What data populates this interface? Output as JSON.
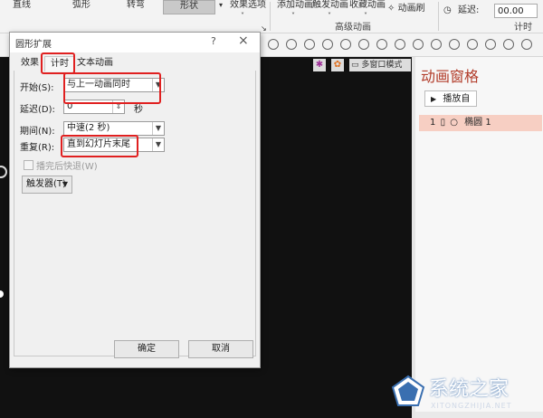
{
  "ribbon": {
    "tabs": [
      "直线",
      "弧形",
      "转弯",
      "形状"
    ],
    "selected_tab": "形状",
    "effect_options": "效果选项",
    "adv_buttons": [
      "添加动画",
      "触发动画",
      "收藏动画"
    ],
    "anim_painter": "动画刷",
    "group_advanced": "高级动画",
    "delay_label": "延迟:",
    "delay_value": "00.00",
    "group_timing": "计时"
  },
  "toolbar2": {
    "multi_window": "多窗口模式"
  },
  "anim_pane": {
    "title": "动画窗格",
    "play_from": "播放自",
    "item_index": "1",
    "item_name": "椭圆 1"
  },
  "dialog": {
    "title": "圆形扩展",
    "help": "?",
    "close": "×",
    "tabs": [
      "效果",
      "计时",
      "文本动画"
    ],
    "active_tab": "计时",
    "start_label": "开始(S):",
    "start_value": "与上一动画同时",
    "delay_label": "延迟(D):",
    "delay_value": "0",
    "delay_unit": "秒",
    "period_label": "期间(N):",
    "period_value": "中速(2 秒)",
    "repeat_label": "重复(R):",
    "repeat_value": "直到幻灯片末尾",
    "rewind_label": "播完后快退(W)",
    "trigger_label": "触发器(T)",
    "ok_label": "确定",
    "cancel_label": "取消"
  },
  "watermark": {
    "text_cn": "系统之家",
    "text_en": "XITONGZHIJIA.NET"
  },
  "colors": {
    "accent_red": "#e02020",
    "pane_title": "#b23c2a",
    "anim_item_bg": "#f7cfc3"
  }
}
